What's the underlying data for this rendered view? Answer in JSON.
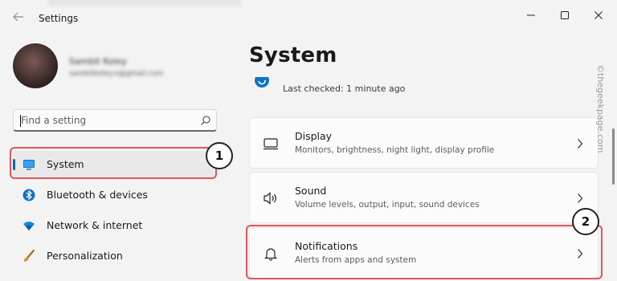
{
  "window": {
    "title": "Settings",
    "controls": {
      "minimize": "–",
      "maximize": "☐",
      "close": "✕"
    }
  },
  "profile": {
    "name": "Sambit Koley",
    "email": "sambitkoley.x@gmail.com"
  },
  "search": {
    "placeholder": "Find a setting",
    "icon": "search-icon"
  },
  "sidebar": {
    "items": [
      {
        "label": "System",
        "icon": "monitor-icon",
        "active": true
      },
      {
        "label": "Bluetooth & devices",
        "icon": "bluetooth-icon",
        "active": false
      },
      {
        "label": "Network & internet",
        "icon": "wifi-icon",
        "active": false
      },
      {
        "label": "Personalization",
        "icon": "brush-icon",
        "active": false
      }
    ]
  },
  "main": {
    "title": "System",
    "update_status": "Last checked: 1 minute ago",
    "cards": [
      {
        "title": "Display",
        "subtitle": "Monitors, brightness, night light, display profile",
        "icon": "display-icon"
      },
      {
        "title": "Sound",
        "subtitle": "Volume levels, output, input, sound devices",
        "icon": "speaker-icon"
      },
      {
        "title": "Notifications",
        "subtitle": "Alerts from apps and system",
        "icon": "bell-icon"
      }
    ]
  },
  "annotations": {
    "badge_1": "1",
    "badge_2": "2"
  },
  "watermark": "©thegeekpage.com",
  "colors": {
    "accent": "#0067c0",
    "callout": "#e0565a",
    "background": "#f3f3f3",
    "card": "#fbfbfb"
  }
}
